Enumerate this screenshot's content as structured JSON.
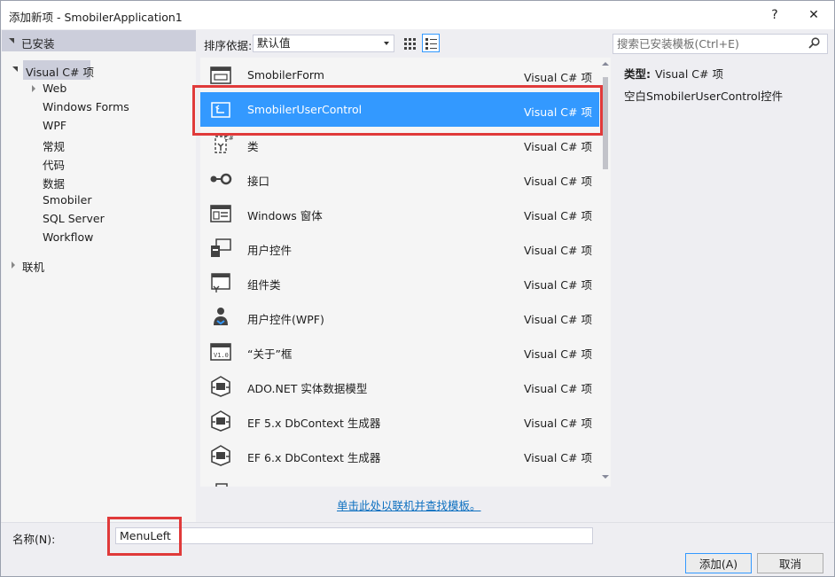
{
  "window": {
    "title": "添加新项 - SmobilerApplication1",
    "help_label": "?",
    "close_label": "✕"
  },
  "left": {
    "header": "已安装",
    "tree": {
      "root_label": "Visual C# 项",
      "children": [
        "Web",
        "Windows Forms",
        "WPF",
        "常规",
        "代码",
        "数据",
        "Smobiler",
        "SQL Server",
        "Workflow"
      ],
      "online_label": "联机"
    }
  },
  "toolbar": {
    "sort_label": "排序依据:",
    "sort_value": "默认值"
  },
  "search": {
    "placeholder": "搜索已安装模板(Ctrl+E)"
  },
  "templates": [
    {
      "name": "SmobilerForm",
      "lang": "Visual C# 项",
      "icon": "form-icon"
    },
    {
      "name": "SmobilerUserControl",
      "lang": "Visual C# 项",
      "icon": "user-control-icon"
    },
    {
      "name": "类",
      "lang": "Visual C# 项",
      "icon": "class-icon"
    },
    {
      "name": "接口",
      "lang": "Visual C# 项",
      "icon": "interface-icon"
    },
    {
      "name": "Windows 窗体",
      "lang": "Visual C# 项",
      "icon": "windows-form-icon"
    },
    {
      "name": "用户控件",
      "lang": "Visual C# 项",
      "icon": "user-control-icon"
    },
    {
      "name": "组件类",
      "lang": "Visual C# 项",
      "icon": "component-icon"
    },
    {
      "name": "用户控件(WPF)",
      "lang": "Visual C# 项",
      "icon": "wpf-user-control-icon"
    },
    {
      "name": "“关于”框",
      "lang": "Visual C# 项",
      "icon": "about-box-icon"
    },
    {
      "name": "ADO.NET 实体数据模型",
      "lang": "Visual C# 项",
      "icon": "entity-model-icon"
    },
    {
      "name": "EF 5.x DbContext 生成器",
      "lang": "Visual C# 项",
      "icon": "dbcontext-generator-icon"
    },
    {
      "name": "EF 6.x DbContext 生成器",
      "lang": "Visual C# 项",
      "icon": "dbcontext-generator-icon"
    }
  ],
  "online_link": "单击此处以联机并查找模板。",
  "details": {
    "type_label": "类型:",
    "type_value": "Visual C# 项",
    "description": "空白SmobilerUserControl控件"
  },
  "bottom": {
    "name_label": "名称(N):",
    "name_value": "MenuLeft",
    "add_label": "添加(A)",
    "cancel_label": "取消"
  },
  "colors": {
    "selection": "#3399ff",
    "highlight": "#e03a3a",
    "link": "#0e70c0"
  }
}
